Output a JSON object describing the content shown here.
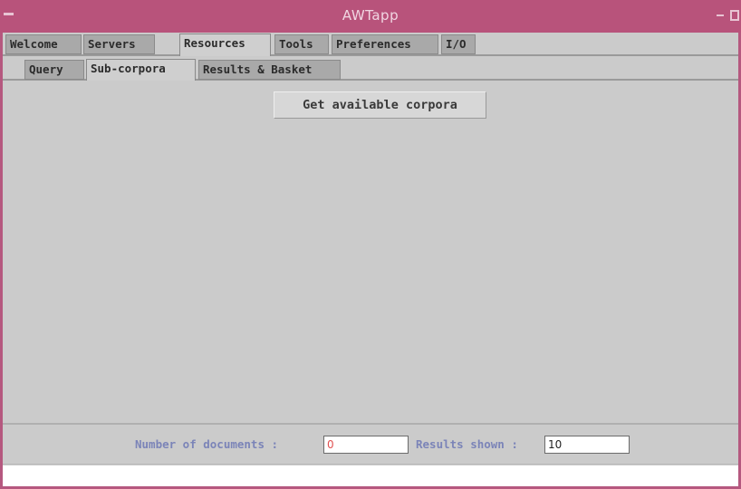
{
  "window": {
    "title": "AWTapp"
  },
  "main_tabs": [
    {
      "label": "Welcome",
      "active": false
    },
    {
      "label": "Servers",
      "active": false
    },
    {
      "label": "Resources",
      "active": true
    },
    {
      "label": "Tools",
      "active": false
    },
    {
      "label": "Preferences",
      "active": false
    },
    {
      "label": "I/O",
      "active": false
    }
  ],
  "sub_tabs": [
    {
      "label": "Query",
      "active": false
    },
    {
      "label": "Sub-corpora",
      "active": true
    },
    {
      "label": "Results & Basket",
      "active": false
    }
  ],
  "content": {
    "get_corpora_label": "Get available corpora"
  },
  "status": {
    "num_documents_label": "Number of documents :",
    "num_documents_value": "0",
    "results_shown_label": "Results shown :",
    "results_shown_value": "10"
  },
  "colors": {
    "titlebar": "#b8537b",
    "label_text": "#7b84b8",
    "doc_count_text": "#e05050"
  }
}
